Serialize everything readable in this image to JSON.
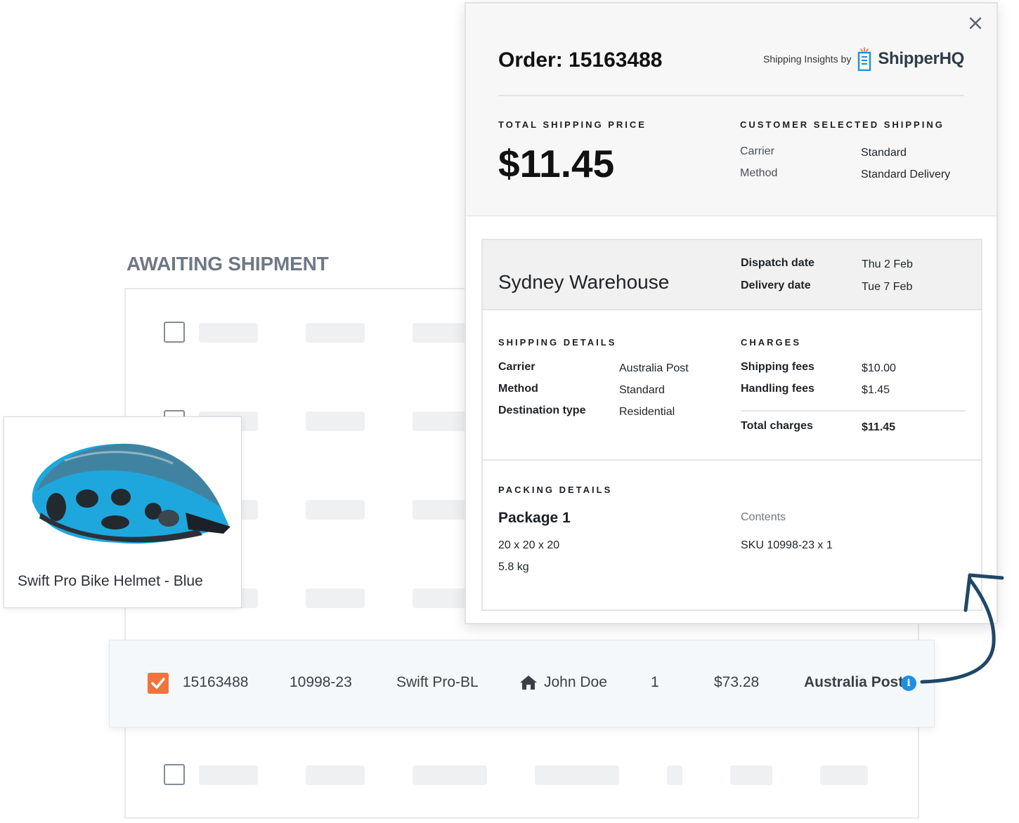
{
  "section_title": "AWAITING SHIPMENT",
  "product_card": {
    "name": "Swift Pro Bike Helmet - Blue",
    "image_icon": "bike-helmet-image"
  },
  "selected_order": {
    "order_id": "15163488",
    "sku": "10998-23",
    "product_code": "Swift Pro-BL",
    "customer": "John Doe",
    "quantity": "1",
    "total": "$73.28",
    "carrier": "Australia Post",
    "info_symbol": "i"
  },
  "modal": {
    "title": "Order: 15163488",
    "insights_label": "Shipping Insights by",
    "brand": "ShipperHQ",
    "total_shipping_label": "TOTAL SHIPPING PRICE",
    "total_shipping_price": "$11.45",
    "customer_selected_label": "CUSTOMER SELECTED SHIPPING",
    "customer_selected": {
      "carrier_key": "Carrier",
      "carrier_value": "Standard",
      "method_key": "Method",
      "method_value": "Standard Delivery"
    },
    "warehouse": {
      "name": "Sydney Warehouse",
      "dispatch_key": "Dispatch date",
      "dispatch_value": "Thu 2 Feb",
      "delivery_key": "Delivery date",
      "delivery_value": "Tue 7 Feb"
    },
    "shipping_details": {
      "label": "SHIPPING DETAILS",
      "carrier_key": "Carrier",
      "carrier_value": "Australia Post",
      "method_key": "Method",
      "method_value": "Standard",
      "destination_key": "Destination type",
      "destination_value": "Residential"
    },
    "charges": {
      "label": "CHARGES",
      "shipping_key": "Shipping fees",
      "shipping_value": "$10.00",
      "handling_key": "Handling fees",
      "handling_value": "$1.45",
      "total_key": "Total charges",
      "total_value": "$11.45"
    },
    "packing_details": {
      "label": "PACKING DETAILS",
      "package_name": "Package 1",
      "dimensions": "20 x 20 x 20",
      "weight": "5.8 kg",
      "contents_label": "Contents",
      "contents_value": "SKU 10998-23 x 1"
    }
  },
  "colors": {
    "accent_orange": "#f0743d",
    "info_blue": "#1e8fe0",
    "arrow_navy": "#1f4768",
    "helmet_blue": "#1ea7dd"
  }
}
